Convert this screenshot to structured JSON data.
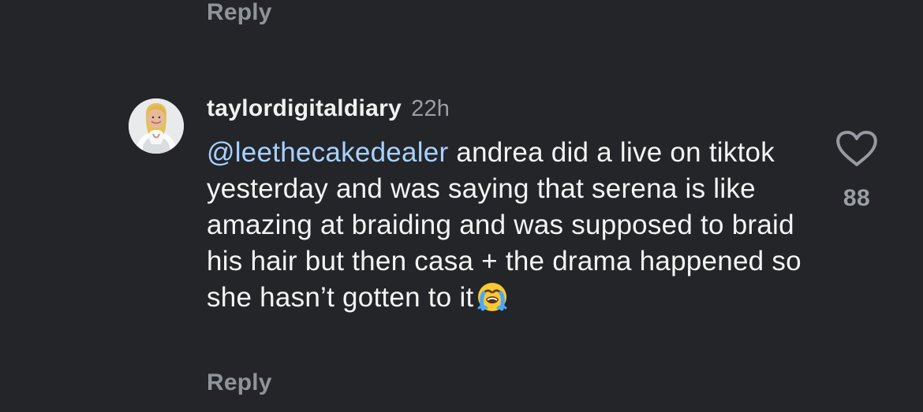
{
  "previous_comment": {
    "reply_label": "Reply"
  },
  "comment": {
    "username": "taylordigitaldiary",
    "timestamp": "22h",
    "mention": "@leethecakedealer",
    "text": " andrea did a live on tiktok yesterday and was saying that serena is like amazing at braiding and was supposed to braid his hair but then casa + the drama happened so she hasn’t gotten to it",
    "emoji": "loudly-crying-face",
    "reply_label": "Reply",
    "like_count": "88",
    "like_icon": "heart-outline-icon"
  },
  "colors": {
    "background": "#232529",
    "text": "#f4f4f4",
    "muted": "#8f939a",
    "mention": "#a8d1ff"
  }
}
